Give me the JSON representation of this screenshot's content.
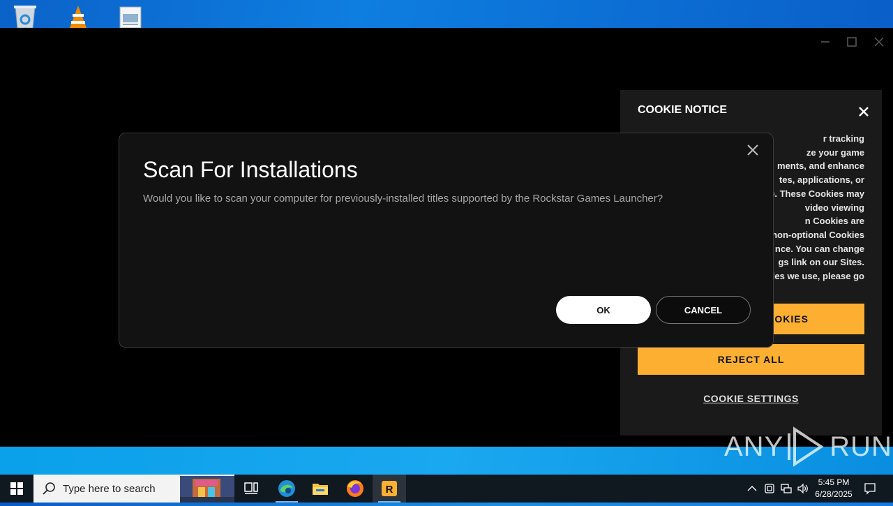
{
  "dialog": {
    "title": "Scan For Installations",
    "message": "Would you like to scan your computer for previously-installed titles supported by the Rockstar Games Launcher?",
    "ok_label": "OK",
    "cancel_label": "CANCEL"
  },
  "cookie": {
    "title": "COOKIE NOTICE",
    "body_lines": [
      "r tracking",
      "ze your game",
      "ments, and enhance",
      "tes, applications, or",
      "). These Cookies may",
      " video viewing",
      "n Cookies are",
      "non-optional Cookies",
      "nce. You can change",
      "gs link on our Sites.",
      "ies we use, please go"
    ],
    "accept_label": "OKIES",
    "reject_label": "REJECT ALL",
    "settings_label": "COOKIE SETTINGS",
    "accent_color": "#fcaf31"
  },
  "taskbar": {
    "search_placeholder": "Type here to search",
    "time": "5:45 PM",
    "date": "6/28/2025"
  },
  "watermark": {
    "text_left": "ANY",
    "text_right": "RUN"
  },
  "icons": [
    "recycle-bin-icon",
    "vlc-icon",
    "file-icon",
    "windows-icon",
    "search-icon",
    "task-view-icon",
    "edge-icon",
    "file-explorer-icon",
    "firefox-icon",
    "rockstar-icon",
    "chevron-up-icon",
    "tray-app-icon",
    "network-icon",
    "volume-icon",
    "notification-icon"
  ]
}
